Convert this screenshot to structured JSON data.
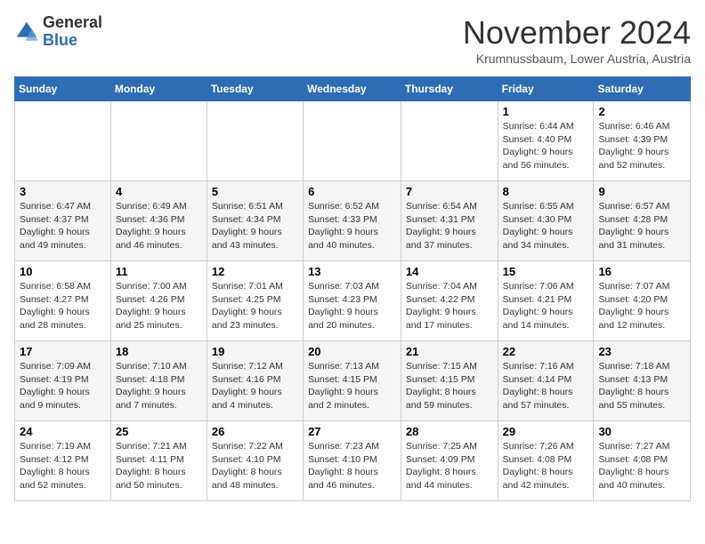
{
  "header": {
    "logo_line1": "General",
    "logo_line2": "Blue",
    "month_title": "November 2024",
    "subtitle": "Krumnussbaum, Lower Austria, Austria"
  },
  "calendar": {
    "days_of_week": [
      "Sunday",
      "Monday",
      "Tuesday",
      "Wednesday",
      "Thursday",
      "Friday",
      "Saturday"
    ],
    "weeks": [
      [
        {
          "day": "",
          "info": ""
        },
        {
          "day": "",
          "info": ""
        },
        {
          "day": "",
          "info": ""
        },
        {
          "day": "",
          "info": ""
        },
        {
          "day": "",
          "info": ""
        },
        {
          "day": "1",
          "info": "Sunrise: 6:44 AM\nSunset: 4:40 PM\nDaylight: 9 hours and 56 minutes."
        },
        {
          "day": "2",
          "info": "Sunrise: 6:46 AM\nSunset: 4:39 PM\nDaylight: 9 hours and 52 minutes."
        }
      ],
      [
        {
          "day": "3",
          "info": "Sunrise: 6:47 AM\nSunset: 4:37 PM\nDaylight: 9 hours and 49 minutes."
        },
        {
          "day": "4",
          "info": "Sunrise: 6:49 AM\nSunset: 4:36 PM\nDaylight: 9 hours and 46 minutes."
        },
        {
          "day": "5",
          "info": "Sunrise: 6:51 AM\nSunset: 4:34 PM\nDaylight: 9 hours and 43 minutes."
        },
        {
          "day": "6",
          "info": "Sunrise: 6:52 AM\nSunset: 4:33 PM\nDaylight: 9 hours and 40 minutes."
        },
        {
          "day": "7",
          "info": "Sunrise: 6:54 AM\nSunset: 4:31 PM\nDaylight: 9 hours and 37 minutes."
        },
        {
          "day": "8",
          "info": "Sunrise: 6:55 AM\nSunset: 4:30 PM\nDaylight: 9 hours and 34 minutes."
        },
        {
          "day": "9",
          "info": "Sunrise: 6:57 AM\nSunset: 4:28 PM\nDaylight: 9 hours and 31 minutes."
        }
      ],
      [
        {
          "day": "10",
          "info": "Sunrise: 6:58 AM\nSunset: 4:27 PM\nDaylight: 9 hours and 28 minutes."
        },
        {
          "day": "11",
          "info": "Sunrise: 7:00 AM\nSunset: 4:26 PM\nDaylight: 9 hours and 25 minutes."
        },
        {
          "day": "12",
          "info": "Sunrise: 7:01 AM\nSunset: 4:25 PM\nDaylight: 9 hours and 23 minutes."
        },
        {
          "day": "13",
          "info": "Sunrise: 7:03 AM\nSunset: 4:23 PM\nDaylight: 9 hours and 20 minutes."
        },
        {
          "day": "14",
          "info": "Sunrise: 7:04 AM\nSunset: 4:22 PM\nDaylight: 9 hours and 17 minutes."
        },
        {
          "day": "15",
          "info": "Sunrise: 7:06 AM\nSunset: 4:21 PM\nDaylight: 9 hours and 14 minutes."
        },
        {
          "day": "16",
          "info": "Sunrise: 7:07 AM\nSunset: 4:20 PM\nDaylight: 9 hours and 12 minutes."
        }
      ],
      [
        {
          "day": "17",
          "info": "Sunrise: 7:09 AM\nSunset: 4:19 PM\nDaylight: 9 hours and 9 minutes."
        },
        {
          "day": "18",
          "info": "Sunrise: 7:10 AM\nSunset: 4:18 PM\nDaylight: 9 hours and 7 minutes."
        },
        {
          "day": "19",
          "info": "Sunrise: 7:12 AM\nSunset: 4:16 PM\nDaylight: 9 hours and 4 minutes."
        },
        {
          "day": "20",
          "info": "Sunrise: 7:13 AM\nSunset: 4:15 PM\nDaylight: 9 hours and 2 minutes."
        },
        {
          "day": "21",
          "info": "Sunrise: 7:15 AM\nSunset: 4:15 PM\nDaylight: 8 hours and 59 minutes."
        },
        {
          "day": "22",
          "info": "Sunrise: 7:16 AM\nSunset: 4:14 PM\nDaylight: 8 hours and 57 minutes."
        },
        {
          "day": "23",
          "info": "Sunrise: 7:18 AM\nSunset: 4:13 PM\nDaylight: 8 hours and 55 minutes."
        }
      ],
      [
        {
          "day": "24",
          "info": "Sunrise: 7:19 AM\nSunset: 4:12 PM\nDaylight: 8 hours and 52 minutes."
        },
        {
          "day": "25",
          "info": "Sunrise: 7:21 AM\nSunset: 4:11 PM\nDaylight: 8 hours and 50 minutes."
        },
        {
          "day": "26",
          "info": "Sunrise: 7:22 AM\nSunset: 4:10 PM\nDaylight: 8 hours and 48 minutes."
        },
        {
          "day": "27",
          "info": "Sunrise: 7:23 AM\nSunset: 4:10 PM\nDaylight: 8 hours and 46 minutes."
        },
        {
          "day": "28",
          "info": "Sunrise: 7:25 AM\nSunset: 4:09 PM\nDaylight: 8 hours and 44 minutes."
        },
        {
          "day": "29",
          "info": "Sunrise: 7:26 AM\nSunset: 4:08 PM\nDaylight: 8 hours and 42 minutes."
        },
        {
          "day": "30",
          "info": "Sunrise: 7:27 AM\nSunset: 4:08 PM\nDaylight: 8 hours and 40 minutes."
        }
      ]
    ]
  }
}
